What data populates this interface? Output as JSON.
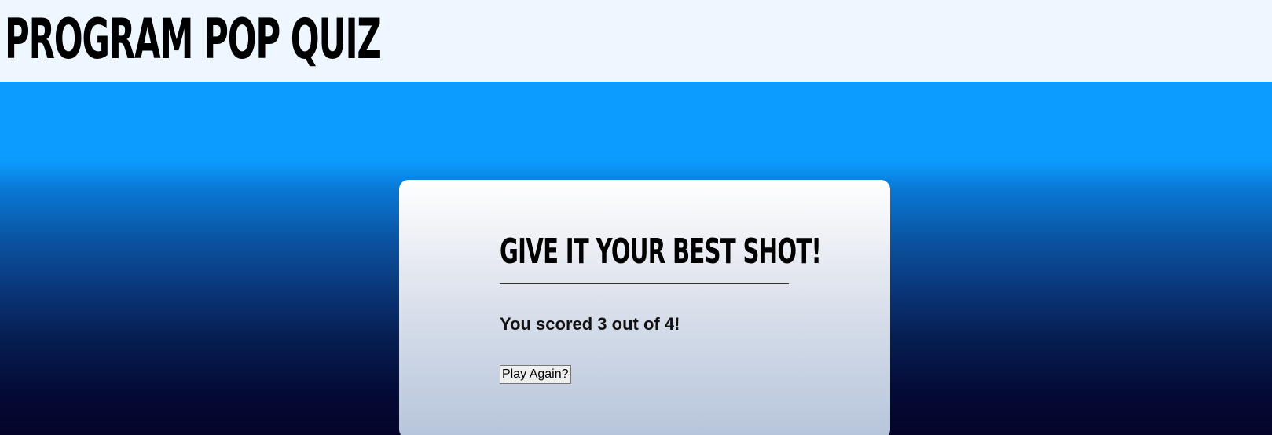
{
  "header": {
    "title": "PROGRAM POP QUIZ"
  },
  "card": {
    "heading": "GIVE IT YOUR BEST SHOT!",
    "score_text": "You scored 3 out of 4!",
    "play_again_label": "Play Again?"
  },
  "colors": {
    "header_background": "#eef6ff",
    "sky_blue": "#0c9cff",
    "deep_navy": "#04042a",
    "card_top": "#ffffff",
    "card_bottom": "#b6c4da"
  }
}
